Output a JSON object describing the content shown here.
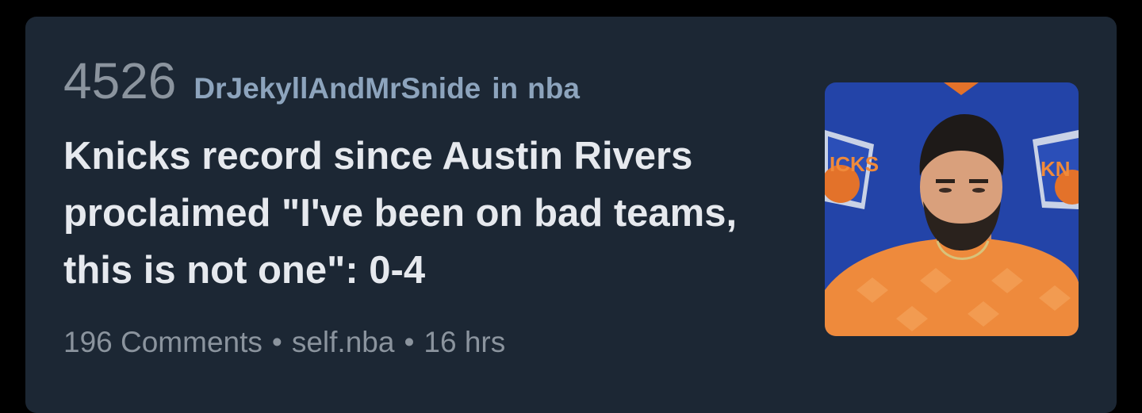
{
  "post": {
    "score": "4526",
    "author": "DrJekyllAndMrSnide",
    "in_label": "in",
    "subreddit": "nba",
    "title": "Knicks record since Austin Rivers proclaimed \"I've been on bad teams, this is not one\": 0-4",
    "comments": "196 Comments",
    "separator": "•",
    "domain": "self.nba",
    "age": "16 hrs"
  },
  "thumbnail": {
    "logo_text_left": "ICKS",
    "logo_text_right": "KN"
  },
  "colors": {
    "card_background": "#1c2734",
    "page_background": "#000000",
    "meta_text": "#8da4bd",
    "title_text": "#e6e9ee",
    "muted_text": "#8b949e"
  }
}
